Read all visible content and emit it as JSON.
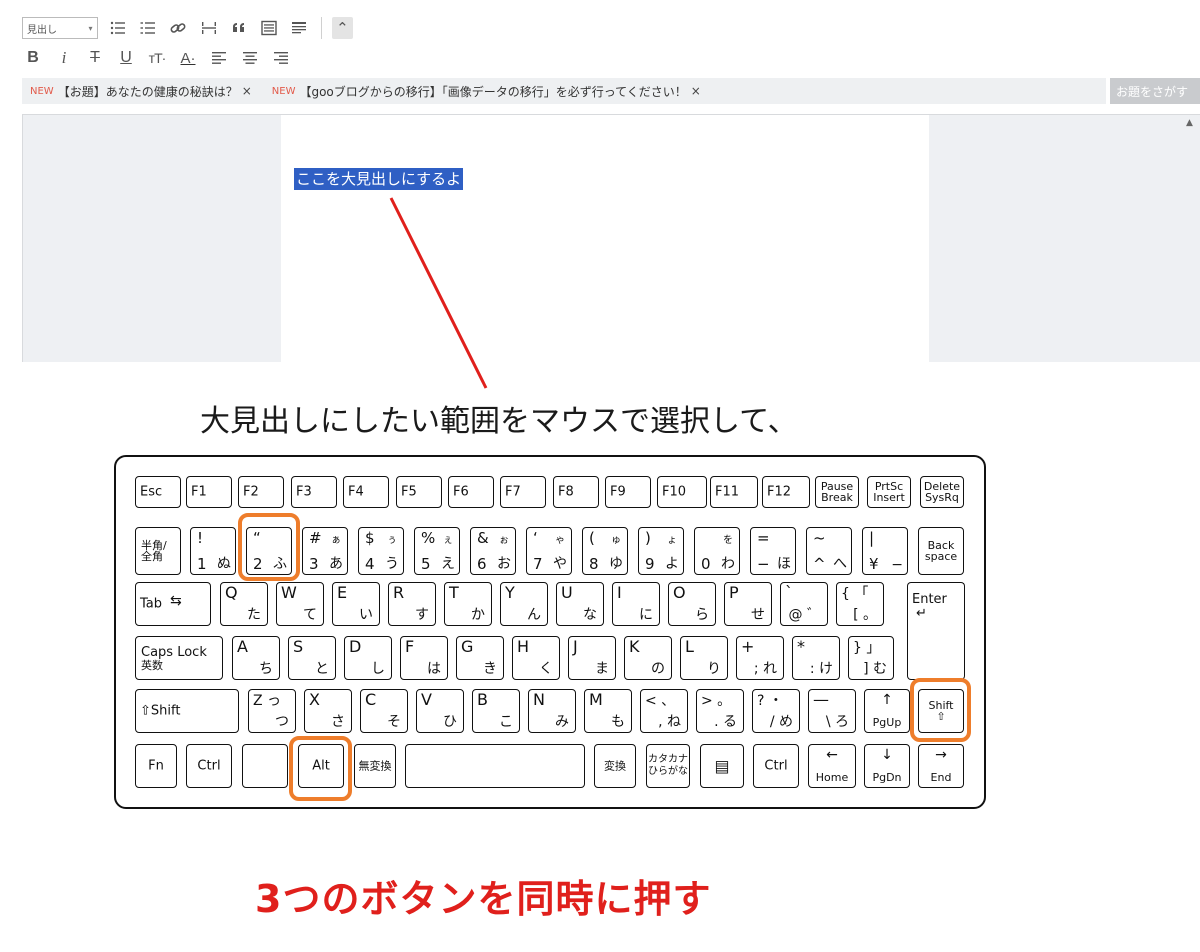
{
  "toolbar": {
    "heading_select": {
      "value": "見出し",
      "arrow": "▾"
    },
    "row1_buttons": [
      {
        "name": "bullet-list-icon",
        "glyph": "☰"
      },
      {
        "name": "numbered-list-icon",
        "glyph": "☷"
      },
      {
        "name": "link-icon",
        "glyph": "🔗"
      },
      {
        "name": "horizontal-rule-icon",
        "glyph": "⇔"
      },
      {
        "name": "quote-icon",
        "glyph": "❝"
      },
      {
        "name": "table-of-contents-icon",
        "glyph": "▤"
      },
      {
        "name": "paragraph-format-icon",
        "glyph": "≡"
      }
    ],
    "collapse": {
      "glyph": "⌃"
    },
    "row2_buttons": [
      {
        "name": "bold-button",
        "label": "B"
      },
      {
        "name": "italic-button",
        "label": "i"
      },
      {
        "name": "strikethrough-button",
        "label": "T"
      },
      {
        "name": "underline-button",
        "label": "U"
      },
      {
        "name": "font-size-button",
        "label": "тT·"
      },
      {
        "name": "font-color-button",
        "label": "A·"
      },
      {
        "name": "align-left-button",
        "label": ""
      },
      {
        "name": "align-center-button",
        "label": ""
      },
      {
        "name": "align-right-button",
        "label": ""
      }
    ]
  },
  "topics": [
    {
      "badge": "NEW",
      "text": "【お題】あなたの健康の秘訣は？",
      "close": "×"
    },
    {
      "badge": "NEW",
      "text": "【gooブログからの移行】「画像データの移行」を必ず行ってください！",
      "close": "×"
    }
  ],
  "topic_search": "お題をさがす",
  "editor": {
    "selected_text": "ここを大見出しにするよ"
  },
  "instruction1": "大見出しにしたい範囲をマウスで選択して、",
  "instruction2": "3つのボタンを同時に押す",
  "colors": {
    "selection": "#2f5fc4",
    "highlight": "#ee7d2b",
    "arrow": "#e0201c",
    "instruction2": "#e0201c"
  },
  "keyboard": {
    "fn_row": [
      "Esc",
      "F1",
      "F2",
      "F3",
      "F4",
      "F5",
      "F6",
      "F7",
      "F8",
      "F9",
      "F10",
      "F11",
      "F12"
    ],
    "pause": [
      "Pause",
      "Break"
    ],
    "prtsc": [
      "PrtSc",
      "Insert"
    ],
    "delete": [
      "Delete",
      "SysRq"
    ],
    "hankaku": [
      "半角/",
      "全角"
    ],
    "number_row": [
      {
        "tl": "!",
        "bl": "1",
        "kana": "ぬ",
        "tr": ""
      },
      {
        "tl": "“",
        "bl": "2",
        "kana": "ふ",
        "tr": ""
      },
      {
        "tl": "#",
        "bl": "3",
        "kana": "あ",
        "tr": "ぁ"
      },
      {
        "tl": "$",
        "bl": "4",
        "kana": "う",
        "tr": "ぅ"
      },
      {
        "tl": "%",
        "bl": "5",
        "kana": "え",
        "tr": "ぇ"
      },
      {
        "tl": "&",
        "bl": "6",
        "kana": "お",
        "tr": "ぉ"
      },
      {
        "tl": "‘",
        "bl": "7",
        "kana": "や",
        "tr": "ゃ"
      },
      {
        "tl": "(",
        "bl": "8",
        "kana": "ゆ",
        "tr": "ゅ"
      },
      {
        "tl": ")",
        "bl": "9",
        "kana": "よ",
        "tr": "ょ"
      },
      {
        "tl": "",
        "bl": "0",
        "kana": "わ",
        "tr": "を"
      },
      {
        "tl": "=",
        "bl": "−",
        "kana": "ほ",
        "tr": ""
      },
      {
        "tl": "~",
        "bl": "^",
        "kana": "へ",
        "tr": ""
      },
      {
        "tl": "|",
        "bl": "¥",
        "kana": "−",
        "tr": ""
      }
    ],
    "backspace": [
      "Back",
      "space"
    ],
    "tab": "Tab",
    "qwerty_row": [
      {
        "l": "Q",
        "k": "た"
      },
      {
        "l": "W",
        "k": "て"
      },
      {
        "l": "E",
        "k": "い"
      },
      {
        "l": "R",
        "k": "す"
      },
      {
        "l": "T",
        "k": "か"
      },
      {
        "l": "Y",
        "k": "ん"
      },
      {
        "l": "U",
        "k": "な"
      },
      {
        "l": "I",
        "k": "に"
      },
      {
        "l": "O",
        "k": "ら"
      },
      {
        "l": "P",
        "k": "せ"
      },
      {
        "l": "`",
        "k": "@ ゛"
      },
      {
        "l": "{ 「",
        "k": "[ 。"
      }
    ],
    "enter": "Enter",
    "caps": [
      "Caps Lock",
      "英数"
    ],
    "asdf_row": [
      {
        "l": "A",
        "k": "ち"
      },
      {
        "l": "S",
        "k": "と"
      },
      {
        "l": "D",
        "k": "し"
      },
      {
        "l": "F",
        "k": "は"
      },
      {
        "l": "G",
        "k": "き"
      },
      {
        "l": "H",
        "k": "く"
      },
      {
        "l": "J",
        "k": "ま"
      },
      {
        "l": "K",
        "k": "の"
      },
      {
        "l": "L",
        "k": "り"
      },
      {
        "l": "+",
        "k": "; れ"
      },
      {
        "l": "*",
        "k": ": け"
      },
      {
        "l": "} 」",
        "k": "] む"
      }
    ],
    "shift_left": "⇧Shift",
    "zxcv_row": [
      {
        "l": "Z っ",
        "k": "つ"
      },
      {
        "l": "X",
        "k": "さ"
      },
      {
        "l": "C",
        "k": "そ"
      },
      {
        "l": "V",
        "k": "ひ"
      },
      {
        "l": "B",
        "k": "こ"
      },
      {
        "l": "N",
        "k": "み"
      },
      {
        "l": "M",
        "k": "も"
      },
      {
        "l": "< 、",
        "k": ", ね"
      },
      {
        "l": "> 。",
        "k": ". る"
      },
      {
        "l": "? ・",
        "k": "/ め"
      },
      {
        "l": "—",
        "k": "\\ ろ"
      }
    ],
    "pgup": [
      "↑",
      "PgUp"
    ],
    "shift_right": [
      "Shift",
      "⇧"
    ],
    "bottom": {
      "fn": "Fn",
      "ctrl_left": "Ctrl",
      "alt": "Alt",
      "muhenkan": "無変換",
      "henkan": "変換",
      "katakana": [
        "カタカナ",
        "ひらがな"
      ],
      "menu": "▤",
      "ctrl_right": "Ctrl",
      "home": [
        "←",
        "Home"
      ],
      "pgdn": [
        "↓",
        "PgDn"
      ],
      "end": [
        "→",
        "End"
      ]
    }
  }
}
